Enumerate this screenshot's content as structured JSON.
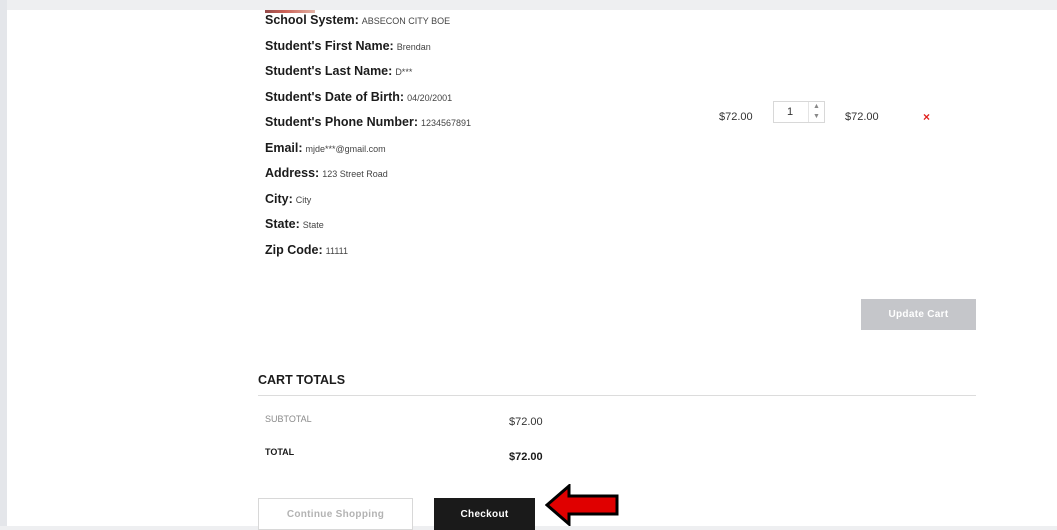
{
  "item": {
    "fields": [
      {
        "label": "School System:",
        "value": "ABSECON CITY BOE"
      },
      {
        "label": "Student's First Name:",
        "value": "Brendan"
      },
      {
        "label": "Student's Last Name:",
        "value": "D***"
      },
      {
        "label": "Student's Date of Birth:",
        "value": "04/20/2001"
      },
      {
        "label": "Student's Phone Number:",
        "value": "1234567891"
      },
      {
        "label": "Email:",
        "value": "mjde***@gmail.com"
      },
      {
        "label": "Address:",
        "value": "123 Street Road"
      },
      {
        "label": "City:",
        "value": "City"
      },
      {
        "label": "State:",
        "value": "State"
      },
      {
        "label": "Zip Code:",
        "value": "11111"
      }
    ],
    "price": "$72.00",
    "quantity": "1",
    "line_total": "$72.00",
    "remove_glyph": "×"
  },
  "cart": {
    "update_label": "Update Cart"
  },
  "totals": {
    "title": "CART TOTALS",
    "subtotal_label": "SUBTOTAL",
    "subtotal_value": "$72.00",
    "total_label": "TOTAL",
    "total_value": "$72.00"
  },
  "actions": {
    "continue_label": "Continue Shopping",
    "checkout_label": "Checkout"
  },
  "icons": {
    "remove": "close-icon",
    "pointer": "arrow-left-icon",
    "spinner_up": "chevron-up-icon",
    "spinner_down": "chevron-down-icon"
  },
  "colors": {
    "remove": "#e0201c",
    "pointer_arrow": "#e00000",
    "checkout_bg": "#1a1a1a",
    "update_bg": "#c5c6ca"
  }
}
